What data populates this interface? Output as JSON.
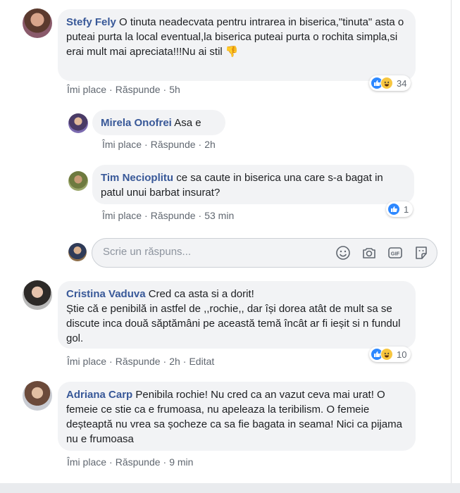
{
  "comments": [
    {
      "author": "Stefy Fely",
      "text": "O tinuta neadecvata pentru intrarea in biserica,\"tinuta\" asta o puteai purta la local eventual,la biserica puteai purta o rochita simpla,si erai mult mai apreciata!!!Nu ai stil",
      "emoji": "👎",
      "like": "Îmi place",
      "reply": "Răspunde",
      "time": "5h",
      "reaction_count": "34"
    },
    {
      "author": "Mirela Onofrei",
      "text": "Asa e",
      "like": "Îmi place",
      "reply": "Răspunde",
      "time": "2h"
    },
    {
      "author": "Tim Necioplitu",
      "text": "ce sa caute in biserica una care s-a bagat in patul unui barbat insurat?",
      "like": "Îmi place",
      "reply": "Răspunde",
      "time": "53 min",
      "reaction_count": "1"
    },
    {
      "author": "Cristina Vaduva",
      "text": "Cred ca asta si a dorit!",
      "text2": "Știe că e penibilă in astfel de ,,rochie,, dar își dorea atât de mult sa se discute inca două săptămâni pe această temă încât ar fi ieșit si n fundul gol.",
      "like": "Îmi place",
      "reply": "Răspunde",
      "time": "2h",
      "edited": "Editat",
      "reaction_count": "10"
    },
    {
      "author": "Adriana Carp",
      "text": "Penibila rochie! Nu cred ca an vazut ceva mai urat! O femeie ce stie ca e frumoasa, nu apeleaza la teribilism. O femeie deșteaptă nu vrea sa șocheze ca sa fie bagata in seama! Nici ca pijama nu e frumoasa",
      "like": "Îmi place",
      "reply": "Răspunde",
      "time": "9 min"
    }
  ],
  "reply_box": {
    "placeholder": "Scrie un răspuns...",
    "icons": [
      "smiley-icon",
      "camera-icon",
      "gif-icon",
      "sticker-icon"
    ]
  },
  "colors": {
    "author": "#385898",
    "bubble": "#f2f3f5",
    "meta": "#606770",
    "like_blue": "#2d88ff",
    "haha_yellow": "#f7c63f"
  }
}
